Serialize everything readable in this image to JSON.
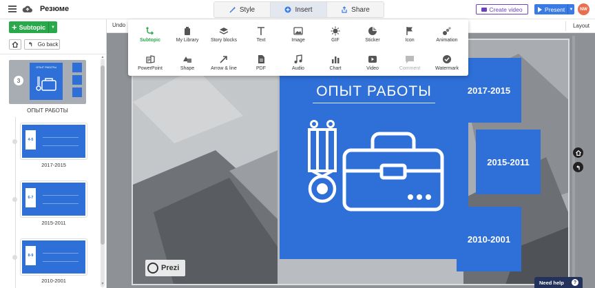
{
  "app": {
    "title": "Резюме",
    "avatar_initials": "NW"
  },
  "mode_tabs": [
    {
      "label": "Style",
      "icon": "wand-icon"
    },
    {
      "label": "Insert",
      "icon": "plus-circle-icon",
      "active": true
    },
    {
      "label": "Share",
      "icon": "share-icon"
    }
  ],
  "header_actions": {
    "create_video": "Create video",
    "present": "Present"
  },
  "toolbar": {
    "undo": "Undo",
    "layout": "Layout"
  },
  "sidebar": {
    "subtopic_button": "Subtopic",
    "go_back": "Go back",
    "main_topic": {
      "number": "3",
      "label": "ОПЫТ РАБОТЫ",
      "thumb_title": "ОПЫТ РАБОТЫ"
    },
    "subtopics": [
      {
        "card": "4-5",
        "label": "2017-2015"
      },
      {
        "card": "6-7",
        "label": "2015-2011"
      },
      {
        "card": "8-9",
        "label": "2010-2001"
      }
    ]
  },
  "insert_menu": {
    "row1": [
      {
        "label": "Subtopic",
        "icon": "subtopic-icon",
        "active": true
      },
      {
        "label": "My Library",
        "icon": "library-icon"
      },
      {
        "label": "Story blocks",
        "icon": "layers-icon"
      },
      {
        "label": "Text",
        "icon": "text-icon"
      },
      {
        "label": "Image",
        "icon": "image-icon"
      },
      {
        "label": "GIF",
        "icon": "gif-icon"
      },
      {
        "label": "Sticker",
        "icon": "sticker-icon"
      },
      {
        "label": "Icon",
        "icon": "flag-icon"
      },
      {
        "label": "Animation",
        "icon": "animation-icon"
      }
    ],
    "row2": [
      {
        "label": "PowerPoint",
        "icon": "powerpoint-icon"
      },
      {
        "label": "Shape",
        "icon": "shape-icon"
      },
      {
        "label": "Arrow & line",
        "icon": "arrow-icon"
      },
      {
        "label": "PDF",
        "icon": "pdf-icon"
      },
      {
        "label": "Audio",
        "icon": "music-icon"
      },
      {
        "label": "Chart",
        "icon": "chart-icon"
      },
      {
        "label": "Video",
        "icon": "video-icon"
      },
      {
        "label": "Comment",
        "icon": "comment-icon",
        "disabled": true
      },
      {
        "label": "Watermark",
        "icon": "watermark-icon"
      }
    ]
  },
  "canvas": {
    "title": "ОПЫТ РАБОТЫ",
    "years": [
      "2017-2015",
      "2015-2011",
      "2010-2001"
    ],
    "logo": "Prezi"
  },
  "help": {
    "label": "Need help",
    "question": "?"
  },
  "colors": {
    "accent_blue": "#2e6fd8",
    "green": "#2aa94a",
    "purple": "#6d3fc1",
    "present_blue": "#3a7ae4",
    "help_navy": "#23325a"
  }
}
